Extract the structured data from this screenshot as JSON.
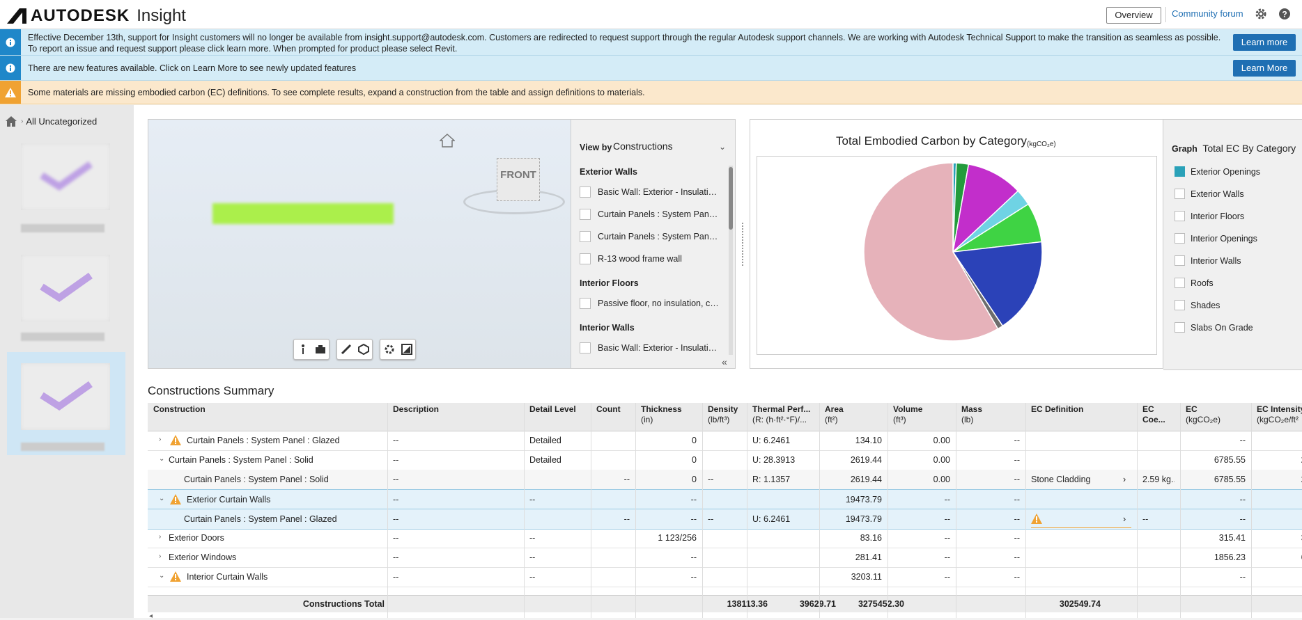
{
  "app": {
    "brand": "AUTODESK",
    "product": "Insight"
  },
  "topbar": {
    "overview": "Overview",
    "forum": "Community forum"
  },
  "banners": [
    {
      "text": "Effective December 13th, support for Insight customers will no longer be available from insight.support@autodesk.com. Customers are redirected to request support through the regular Autodesk support channels. We are working with Autodesk Technical Support to make the transition as seamless as possible. To report an issue and request support please click learn more. When prompted for product please select Revit.",
      "button": "Learn more"
    },
    {
      "text": "There are new features available. Click on Learn More to see newly updated features",
      "button": "Learn More"
    },
    {
      "text": "Some materials are missing embodied carbon (EC) definitions. To see complete results, expand a construction from the table and assign definitions to materials."
    }
  ],
  "breadcrumb": {
    "label": "All Uncategorized"
  },
  "viewer": {
    "cube_label": "FRONT"
  },
  "view_panel": {
    "label": "View by",
    "selected": "Constructions",
    "groups": [
      {
        "name": "Exterior Walls",
        "items": [
          "Basic Wall: Exterior - Insulation on Masonry",
          "Curtain Panels : System Panel : Glazed",
          "Curtain Panels : System Panel : Solid",
          "R-13 wood frame wall"
        ]
      },
      {
        "name": "Interior Floors",
        "items": [
          "Passive floor, no insulation, carpet"
        ]
      },
      {
        "name": "Interior Walls",
        "items": [
          "Basic Wall: Exterior - Insulation on Masonry"
        ]
      }
    ]
  },
  "chart": {
    "title": "Total Embodied Carbon by Category",
    "unit": "(kgCO₂e)"
  },
  "legend_panel": {
    "label": "Graph",
    "selected": "Total EC By Category",
    "items": [
      {
        "name": "Exterior Openings",
        "checked": true,
        "color": "#2aa1b8"
      },
      {
        "name": "Exterior Walls",
        "checked": false
      },
      {
        "name": "Interior Floors",
        "checked": false
      },
      {
        "name": "Interior Openings",
        "checked": false
      },
      {
        "name": "Interior Walls",
        "checked": false
      },
      {
        "name": "Roofs",
        "checked": false
      },
      {
        "name": "Shades",
        "checked": false
      },
      {
        "name": "Slabs On Grade",
        "checked": false
      }
    ]
  },
  "chart_data": {
    "type": "pie",
    "title": "Total Embodied Carbon by Category",
    "unit": "kgCO₂e",
    "slices": [
      {
        "value": 0.6,
        "color": "#2aa1b8"
      },
      {
        "value": 2.2,
        "color": "#239b3c"
      },
      {
        "value": 10.2,
        "color": "#c22ecb"
      },
      {
        "value": 3.0,
        "color": "#6fd3e4"
      },
      {
        "value": 7.2,
        "color": "#3fd344"
      },
      {
        "value": 17.4,
        "color": "#2b42b8"
      },
      {
        "value": 1.0,
        "color": "#6c6c6c"
      },
      {
        "value": 58.4,
        "color": "#e6b2ba"
      }
    ]
  },
  "summary": {
    "title": "Constructions Summary",
    "columns": [
      {
        "label": "Construction",
        "unit": ""
      },
      {
        "label": "Description",
        "unit": ""
      },
      {
        "label": "Detail Level",
        "unit": ""
      },
      {
        "label": "Count",
        "unit": ""
      },
      {
        "label": "Thickness",
        "unit": "(in)"
      },
      {
        "label": "Density",
        "unit": "(lb/ft³)"
      },
      {
        "label": "Thermal Perf...",
        "unit": "(R: (h·ft²·°F)/..."
      },
      {
        "label": "Area",
        "unit": "(ft²)"
      },
      {
        "label": "Volume",
        "unit": "(ft³)"
      },
      {
        "label": "Mass",
        "unit": "(lb)"
      },
      {
        "label": "EC Definition",
        "unit": ""
      },
      {
        "label": "EC Coe...",
        "unit": ""
      },
      {
        "label": "EC",
        "unit": "(kgCO₂e)"
      },
      {
        "label": "EC Intensity",
        "unit": "(kgCO₂e/ft²"
      }
    ],
    "rows": [
      {
        "caret": "▸",
        "warn": true,
        "indent": 0,
        "name": "Curtain Panels : System Panel : Glazed",
        "desc": "--",
        "detail": "Detailed",
        "count": "",
        "thick": "0",
        "density": "",
        "thermal": "U: 6.2461",
        "area": "134.10",
        "volume": "0.00",
        "mass": "--",
        "ecdef": "",
        "eccoe": "",
        "ec": "--",
        "eci": ""
      },
      {
        "caret": "▾",
        "warn": false,
        "indent": 0,
        "name": "Curtain Panels : System Panel : Solid",
        "desc": "--",
        "detail": "Detailed",
        "count": "",
        "thick": "0",
        "density": "",
        "thermal": "U: 28.3913",
        "area": "2619.44",
        "volume": "0.00",
        "mass": "--",
        "ecdef": "",
        "eccoe": "",
        "ec": "6785.55",
        "eci": "2."
      },
      {
        "caret": "",
        "warn": false,
        "indent": 1,
        "name": "Curtain Panels : System Panel : Solid",
        "desc": "--",
        "detail": "",
        "count": "--",
        "thick": "0",
        "density": "--",
        "thermal": "R: 1.1357",
        "area": "2619.44",
        "volume": "0.00",
        "mass": "--",
        "ecdef": "Stone Cladding",
        "eccoe": "2.59 kg...",
        "ec": "6785.55",
        "eci": "2."
      },
      {
        "caret": "▾",
        "warn": true,
        "indent": 0,
        "name": "Exterior Curtain Walls",
        "desc": "--",
        "detail": "--",
        "count": "",
        "thick": "--",
        "density": "",
        "thermal": "",
        "area": "19473.79",
        "volume": "--",
        "mass": "--",
        "ecdef": "",
        "eccoe": "",
        "ec": "--",
        "eci": ""
      },
      {
        "caret": "",
        "warn": false,
        "indent": 1,
        "name": "Curtain Panels : System Panel : Glazed",
        "desc": "--",
        "detail": "",
        "count": "--",
        "thick": "--",
        "density": "--",
        "thermal": "U: 6.2461",
        "area": "19473.79",
        "volume": "--",
        "mass": "--",
        "ecdef": "",
        "eccoe": "--",
        "ec": "--",
        "eci": ""
      },
      {
        "caret": "▸",
        "warn": false,
        "indent": 0,
        "name": "Exterior Doors",
        "desc": "--",
        "detail": "--",
        "count": "",
        "thick": "1 123/256",
        "density": "",
        "thermal": "",
        "area": "83.16",
        "volume": "--",
        "mass": "--",
        "ecdef": "",
        "eccoe": "",
        "ec": "315.41",
        "eci": "3."
      },
      {
        "caret": "▸",
        "warn": false,
        "indent": 0,
        "name": "Exterior Windows",
        "desc": "--",
        "detail": "--",
        "count": "",
        "thick": "--",
        "density": "",
        "thermal": "",
        "area": "281.41",
        "volume": "--",
        "mass": "--",
        "ecdef": "",
        "eccoe": "",
        "ec": "1856.23",
        "eci": "6."
      },
      {
        "caret": "▾",
        "warn": true,
        "indent": 0,
        "name": "Interior Curtain Walls",
        "desc": "--",
        "detail": "--",
        "count": "",
        "thick": "--",
        "density": "",
        "thermal": "",
        "area": "3203.11",
        "volume": "--",
        "mass": "--",
        "ecdef": "",
        "eccoe": "",
        "ec": "--",
        "eci": ""
      }
    ],
    "total": {
      "label": "Constructions Total",
      "area": "138113.36",
      "volume": "39629.71",
      "mass": "3275452.30",
      "ec": "302549.74"
    }
  }
}
